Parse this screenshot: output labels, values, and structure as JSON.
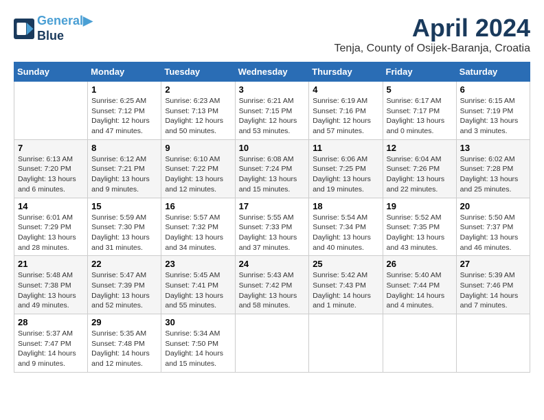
{
  "header": {
    "logo_line1": "General",
    "logo_line2": "Blue",
    "title": "April 2024",
    "subtitle": "Tenja, County of Osijek-Baranja, Croatia"
  },
  "weekdays": [
    "Sunday",
    "Monday",
    "Tuesday",
    "Wednesday",
    "Thursday",
    "Friday",
    "Saturday"
  ],
  "weeks": [
    [
      {
        "day": "",
        "info": ""
      },
      {
        "day": "1",
        "info": "Sunrise: 6:25 AM\nSunset: 7:12 PM\nDaylight: 12 hours\nand 47 minutes."
      },
      {
        "day": "2",
        "info": "Sunrise: 6:23 AM\nSunset: 7:13 PM\nDaylight: 12 hours\nand 50 minutes."
      },
      {
        "day": "3",
        "info": "Sunrise: 6:21 AM\nSunset: 7:15 PM\nDaylight: 12 hours\nand 53 minutes."
      },
      {
        "day": "4",
        "info": "Sunrise: 6:19 AM\nSunset: 7:16 PM\nDaylight: 12 hours\nand 57 minutes."
      },
      {
        "day": "5",
        "info": "Sunrise: 6:17 AM\nSunset: 7:17 PM\nDaylight: 13 hours\nand 0 minutes."
      },
      {
        "day": "6",
        "info": "Sunrise: 6:15 AM\nSunset: 7:19 PM\nDaylight: 13 hours\nand 3 minutes."
      }
    ],
    [
      {
        "day": "7",
        "info": "Sunrise: 6:13 AM\nSunset: 7:20 PM\nDaylight: 13 hours\nand 6 minutes."
      },
      {
        "day": "8",
        "info": "Sunrise: 6:12 AM\nSunset: 7:21 PM\nDaylight: 13 hours\nand 9 minutes."
      },
      {
        "day": "9",
        "info": "Sunrise: 6:10 AM\nSunset: 7:22 PM\nDaylight: 13 hours\nand 12 minutes."
      },
      {
        "day": "10",
        "info": "Sunrise: 6:08 AM\nSunset: 7:24 PM\nDaylight: 13 hours\nand 15 minutes."
      },
      {
        "day": "11",
        "info": "Sunrise: 6:06 AM\nSunset: 7:25 PM\nDaylight: 13 hours\nand 19 minutes."
      },
      {
        "day": "12",
        "info": "Sunrise: 6:04 AM\nSunset: 7:26 PM\nDaylight: 13 hours\nand 22 minutes."
      },
      {
        "day": "13",
        "info": "Sunrise: 6:02 AM\nSunset: 7:28 PM\nDaylight: 13 hours\nand 25 minutes."
      }
    ],
    [
      {
        "day": "14",
        "info": "Sunrise: 6:01 AM\nSunset: 7:29 PM\nDaylight: 13 hours\nand 28 minutes."
      },
      {
        "day": "15",
        "info": "Sunrise: 5:59 AM\nSunset: 7:30 PM\nDaylight: 13 hours\nand 31 minutes."
      },
      {
        "day": "16",
        "info": "Sunrise: 5:57 AM\nSunset: 7:32 PM\nDaylight: 13 hours\nand 34 minutes."
      },
      {
        "day": "17",
        "info": "Sunrise: 5:55 AM\nSunset: 7:33 PM\nDaylight: 13 hours\nand 37 minutes."
      },
      {
        "day": "18",
        "info": "Sunrise: 5:54 AM\nSunset: 7:34 PM\nDaylight: 13 hours\nand 40 minutes."
      },
      {
        "day": "19",
        "info": "Sunrise: 5:52 AM\nSunset: 7:35 PM\nDaylight: 13 hours\nand 43 minutes."
      },
      {
        "day": "20",
        "info": "Sunrise: 5:50 AM\nSunset: 7:37 PM\nDaylight: 13 hours\nand 46 minutes."
      }
    ],
    [
      {
        "day": "21",
        "info": "Sunrise: 5:48 AM\nSunset: 7:38 PM\nDaylight: 13 hours\nand 49 minutes."
      },
      {
        "day": "22",
        "info": "Sunrise: 5:47 AM\nSunset: 7:39 PM\nDaylight: 13 hours\nand 52 minutes."
      },
      {
        "day": "23",
        "info": "Sunrise: 5:45 AM\nSunset: 7:41 PM\nDaylight: 13 hours\nand 55 minutes."
      },
      {
        "day": "24",
        "info": "Sunrise: 5:43 AM\nSunset: 7:42 PM\nDaylight: 13 hours\nand 58 minutes."
      },
      {
        "day": "25",
        "info": "Sunrise: 5:42 AM\nSunset: 7:43 PM\nDaylight: 14 hours\nand 1 minute."
      },
      {
        "day": "26",
        "info": "Sunrise: 5:40 AM\nSunset: 7:44 PM\nDaylight: 14 hours\nand 4 minutes."
      },
      {
        "day": "27",
        "info": "Sunrise: 5:39 AM\nSunset: 7:46 PM\nDaylight: 14 hours\nand 7 minutes."
      }
    ],
    [
      {
        "day": "28",
        "info": "Sunrise: 5:37 AM\nSunset: 7:47 PM\nDaylight: 14 hours\nand 9 minutes."
      },
      {
        "day": "29",
        "info": "Sunrise: 5:35 AM\nSunset: 7:48 PM\nDaylight: 14 hours\nand 12 minutes."
      },
      {
        "day": "30",
        "info": "Sunrise: 5:34 AM\nSunset: 7:50 PM\nDaylight: 14 hours\nand 15 minutes."
      },
      {
        "day": "",
        "info": ""
      },
      {
        "day": "",
        "info": ""
      },
      {
        "day": "",
        "info": ""
      },
      {
        "day": "",
        "info": ""
      }
    ]
  ]
}
